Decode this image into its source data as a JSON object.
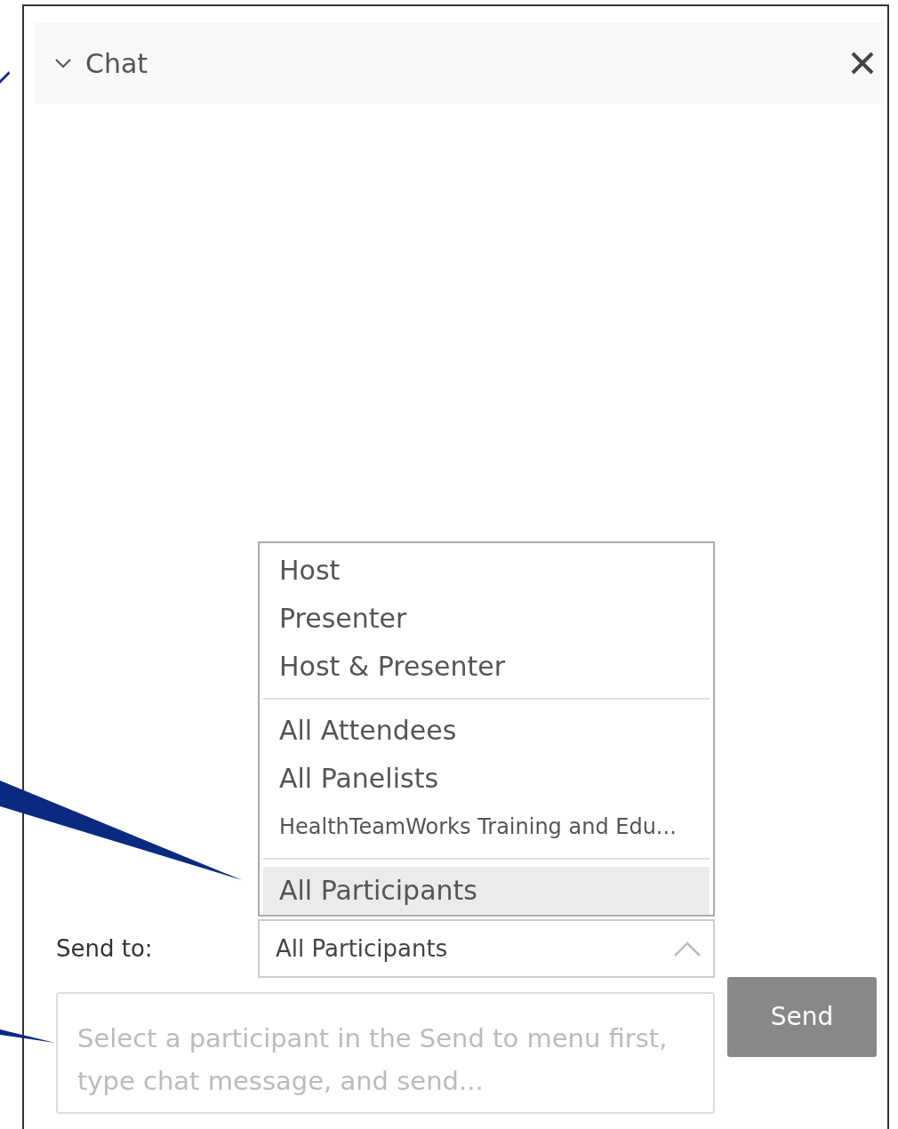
{
  "chat_panel": {
    "title": "Chat",
    "expanded": true
  },
  "recipient_menu": {
    "groups": [
      {
        "options": [
          {
            "label": "Host",
            "kind": "option",
            "selected": false
          },
          {
            "label": "Presenter",
            "kind": "option",
            "selected": false
          },
          {
            "label": "Host & Presenter",
            "kind": "option",
            "selected": false
          }
        ]
      },
      {
        "options": [
          {
            "label": "All Attendees",
            "kind": "option",
            "selected": false
          },
          {
            "label": "All Panelists",
            "kind": "option",
            "selected": false
          },
          {
            "label": "HealthTeamWorks Training and Edu...",
            "kind": "compact",
            "selected": false
          }
        ]
      },
      {
        "options": [
          {
            "label": "All Participants",
            "kind": "option",
            "selected": true
          }
        ]
      }
    ]
  },
  "send_to": {
    "label": "Send to:",
    "value": "All Participants",
    "open": true
  },
  "message": {
    "placeholder": "Select a participant in the Send to menu first, type chat message, and send..."
  },
  "send_button": {
    "label": "Send"
  }
}
